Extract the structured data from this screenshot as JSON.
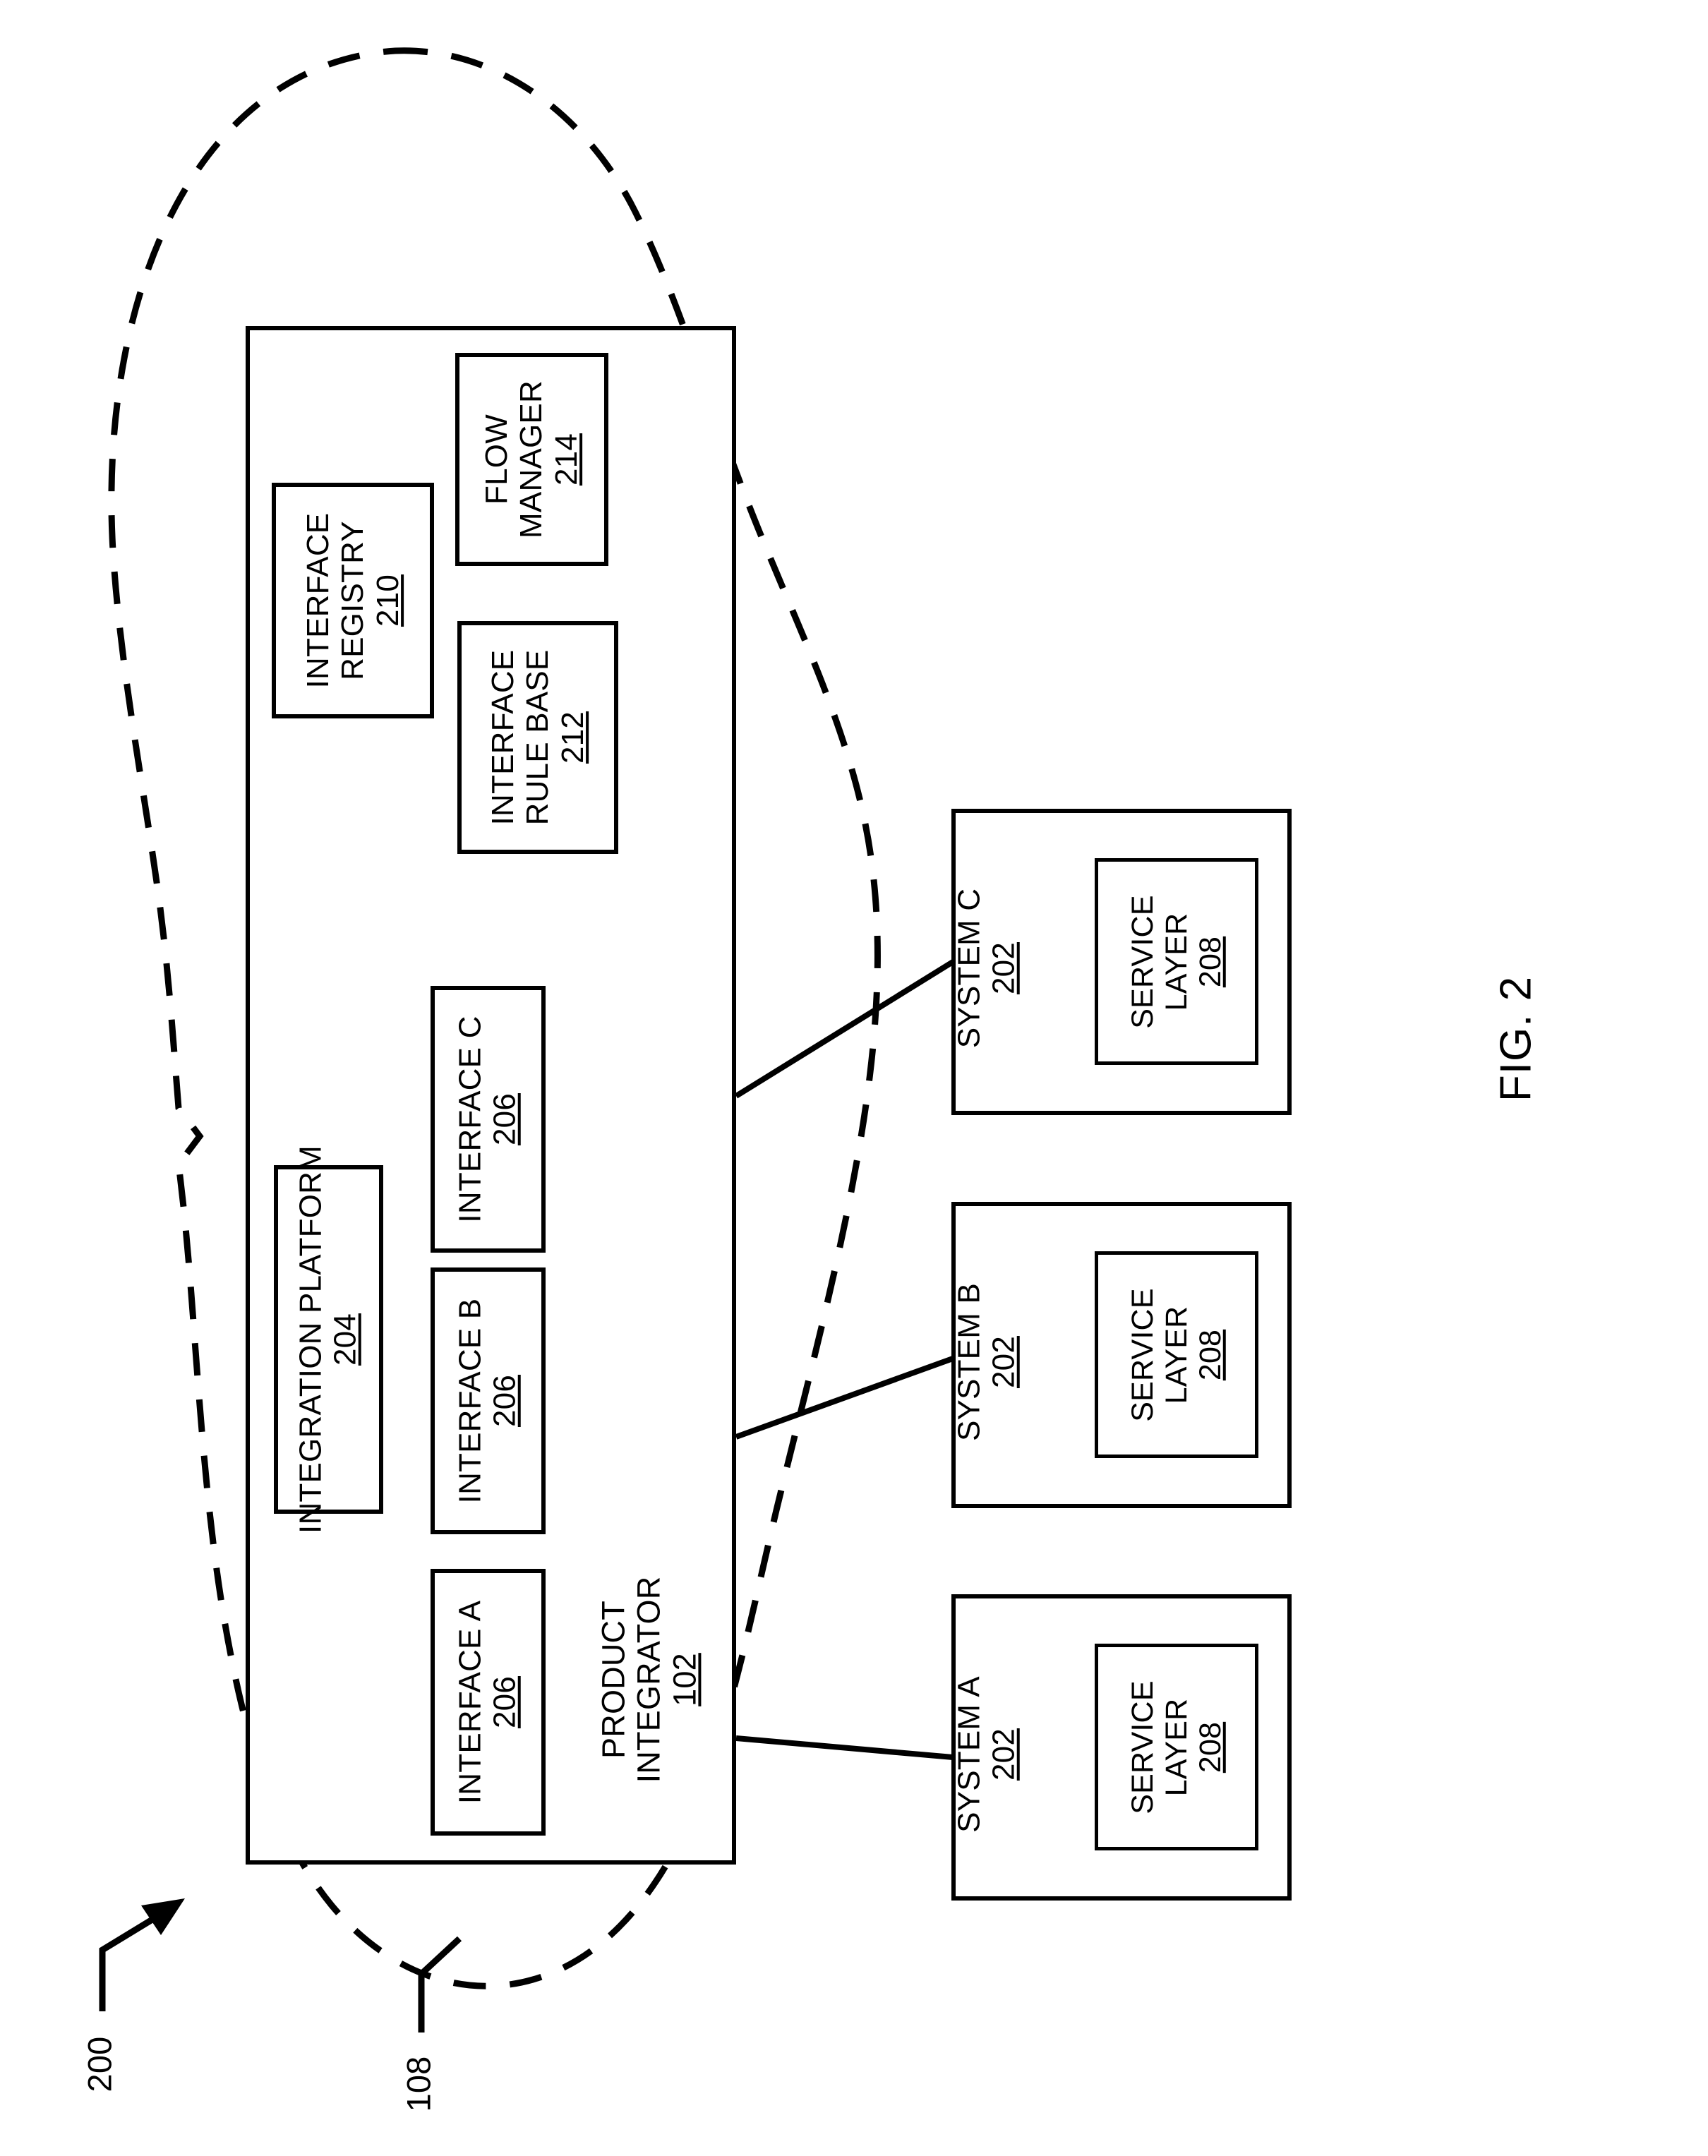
{
  "figure": {
    "label": "FIG. 2",
    "system_ref": "200",
    "network_ref": "108"
  },
  "cloud": {
    "name": "network-cloud",
    "style": "dashed"
  },
  "product_integrator": {
    "title_line1": "PRODUCT",
    "title_line2": "INTEGRATOR",
    "ref": "102",
    "components": [
      {
        "id": "interface-registry",
        "line1": "INTERFACE",
        "line2": "REGISTRY",
        "ref": "210"
      },
      {
        "id": "flow-manager",
        "line1": "FLOW",
        "line2": "MANAGER",
        "ref": "214"
      },
      {
        "id": "interface-rule-base",
        "line1": "INTERFACE",
        "line2": "RULE BASE",
        "ref": "212"
      },
      {
        "id": "integration-platform",
        "line1": "INTEGRATION PLATFORM",
        "line2": "",
        "ref": "204"
      },
      {
        "id": "interface-c",
        "line1": "INTERFACE C",
        "line2": "",
        "ref": "206"
      },
      {
        "id": "interface-b",
        "line1": "INTERFACE B",
        "line2": "",
        "ref": "206"
      },
      {
        "id": "interface-a",
        "line1": "INTERFACE A",
        "line2": "",
        "ref": "206"
      }
    ]
  },
  "systems": [
    {
      "id": "system-c",
      "title": "SYSTEM C",
      "ref": "202",
      "service_layer": {
        "line1": "SERVICE",
        "line2": "LAYER",
        "ref": "208"
      }
    },
    {
      "id": "system-b",
      "title": "SYSTEM B",
      "ref": "202",
      "service_layer": {
        "line1": "SERVICE",
        "line2": "LAYER",
        "ref": "208"
      }
    },
    {
      "id": "system-a",
      "title": "SYSTEM A",
      "ref": "202",
      "service_layer": {
        "line1": "SERVICE",
        "line2": "LAYER",
        "ref": "208"
      }
    }
  ],
  "colors": {
    "line": "#000000",
    "background": "#ffffff"
  }
}
